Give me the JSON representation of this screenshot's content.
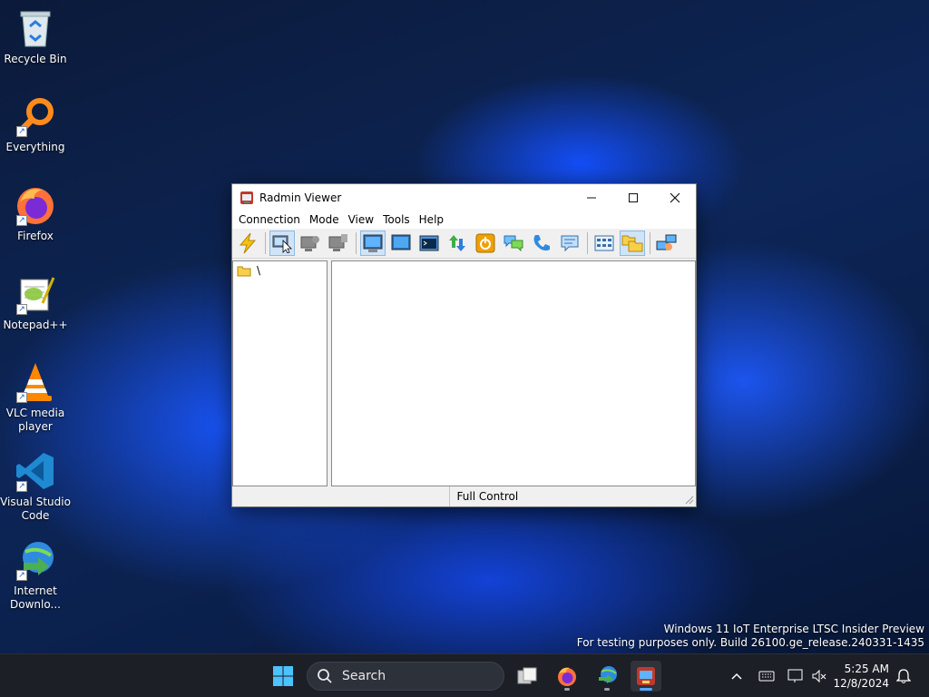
{
  "desktop": {
    "icons": [
      {
        "label": "Recycle Bin"
      },
      {
        "label": "Everything"
      },
      {
        "label": "Firefox"
      },
      {
        "label": "Notepad++"
      },
      {
        "label": "VLC media player"
      },
      {
        "label": "Visual Studio Code"
      },
      {
        "label": "Internet Downlo..."
      }
    ],
    "watermark": {
      "line1": "Windows 11 IoT Enterprise LTSC Insider Preview",
      "line2": "For testing purposes only. Build 26100.ge_release.240331-1435"
    }
  },
  "window": {
    "title": "Radmin Viewer",
    "menu": [
      "Connection",
      "Mode",
      "View",
      "Tools",
      "Help"
    ],
    "tree": {
      "root_label": "\\"
    },
    "status": {
      "mode": "Full Control"
    }
  },
  "taskbar": {
    "search_placeholder": "Search",
    "clock": {
      "time": "5:25 AM",
      "date": "12/8/2024"
    }
  },
  "colors": {
    "accent": "#58a6ff",
    "taskbar": "#1c1f26"
  }
}
